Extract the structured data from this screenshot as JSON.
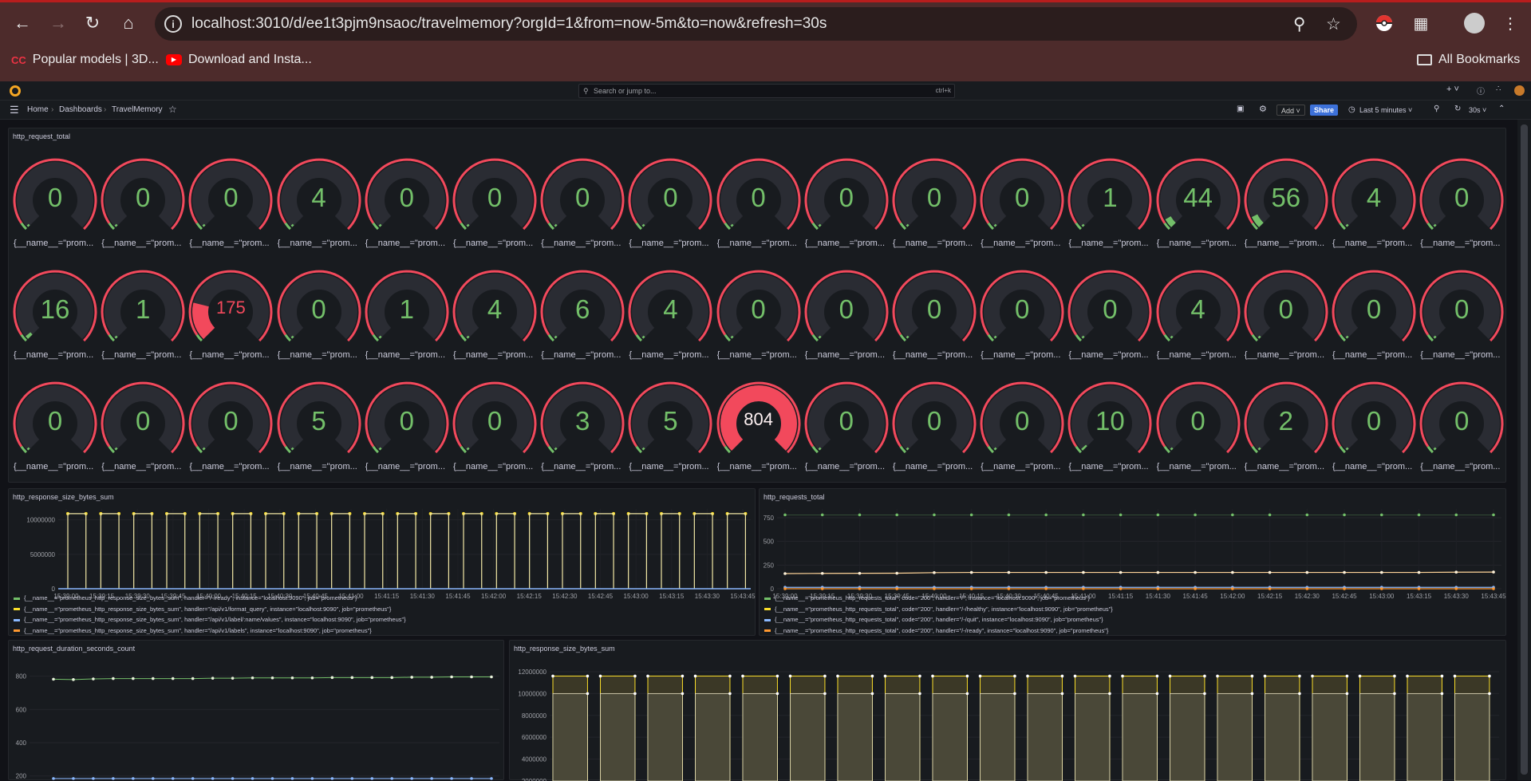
{
  "browser": {
    "url": "localhost:3010/d/ee1t3pjm9nsaoc/travelmemory?orgId=1&from=now-5m&to=now&refresh=30s",
    "bookmarks": [
      "Popular models | 3D...",
      "Download and Insta..."
    ],
    "all_bookmarks": "All Bookmarks",
    "accent": "#4d2b2b"
  },
  "grafana": {
    "search_placeholder": "Search or jump to...",
    "search_shortcut": "ctrl+k",
    "breadcrumb": [
      "Home",
      "Dashboards",
      "TravelMemory"
    ],
    "add_label": "Add",
    "share_label": "Share",
    "time_range": "Last 5 minutes",
    "refresh": "30s"
  },
  "gauge_panel": {
    "title": "http_request_total",
    "label": "{__name__=\"prom...",
    "rows": [
      [
        0,
        0,
        0,
        4,
        0,
        0,
        0,
        0,
        0,
        0,
        0,
        0,
        1,
        44,
        56,
        4,
        0
      ],
      [
        16,
        1,
        175,
        0,
        1,
        4,
        6,
        4,
        0,
        0,
        0,
        0,
        0,
        4,
        0,
        0,
        0
      ],
      [
        0,
        0,
        0,
        5,
        0,
        0,
        3,
        5,
        804,
        0,
        0,
        0,
        10,
        0,
        2,
        0,
        0
      ]
    ],
    "thresholds": {
      "green": "#73bf69",
      "red": "#f2495c"
    }
  },
  "panels": {
    "p1": {
      "title": "http_response_size_bytes_sum",
      "legend": [
        {
          "text": "{__name__=\"prometheus_http_response_size_bytes_sum\", handler=\"/-/ready\", instance=\"localhost:9090\", job=\"prometheus\"}",
          "color": "#73bf69"
        },
        {
          "text": "{__name__=\"prometheus_http_response_size_bytes_sum\", handler=\"/api/v1/format_query\", instance=\"localhost:9090\", job=\"prometheus\"}",
          "color": "#fade2a"
        },
        {
          "text": "{__name__=\"prometheus_http_response_size_bytes_sum\", handler=\"/api/v1/label/:name/values\", instance=\"localhost:9090\", job=\"prometheus\"}",
          "color": "#8ab8ff"
        },
        {
          "text": "{__name__=\"prometheus_http_response_size_bytes_sum\", handler=\"/api/v1/labels\", instance=\"localhost:9090\", job=\"prometheus\"}",
          "color": "#ff9830"
        }
      ]
    },
    "p2": {
      "title": "http_requests_total",
      "legend": [
        {
          "text": "{__name__=\"prometheus_http_requests_total\", code=\"200\", handler=\"/\", instance=\"localhost:9090\", job=\"prometheus\"}",
          "color": "#73bf69"
        },
        {
          "text": "{__name__=\"prometheus_http_requests_total\", code=\"200\", handler=\"/-/healthy\", instance=\"localhost:9090\", job=\"prometheus\"}",
          "color": "#fade2a"
        },
        {
          "text": "{__name__=\"prometheus_http_requests_total\", code=\"200\", handler=\"/-/quit\", instance=\"localhost:9090\", job=\"prometheus\"}",
          "color": "#8ab8ff"
        },
        {
          "text": "{__name__=\"prometheus_http_requests_total\", code=\"200\", handler=\"/-/ready\", instance=\"localhost:9090\", job=\"prometheus\"}",
          "color": "#ff9830"
        }
      ]
    },
    "p3": {
      "title": "http_request_duration_seconds_count"
    },
    "p4": {
      "title": "http_response_size_bytes_sum"
    }
  },
  "chart_data": [
    {
      "type": "line",
      "title": "http_response_size_bytes_sum",
      "x": [
        "15:39:00",
        "15:39:15",
        "15:39:30",
        "15:39:45",
        "15:40:00",
        "15:40:15",
        "15:40:30",
        "15:40:45",
        "15:41:00",
        "15:41:15",
        "15:41:30",
        "15:41:45",
        "15:42:00",
        "15:42:15",
        "15:42:30",
        "15:42:45",
        "15:43:00",
        "15:43:15",
        "15:43:30",
        "15:43:45"
      ],
      "yticks": [
        "0",
        "5000000",
        "10000000"
      ],
      "ylim": [
        0,
        11000000
      ],
      "series": [
        {
          "name": "handler=/api/v1/format_query",
          "pattern": "square wave between 0 and ~11000000"
        }
      ]
    },
    {
      "type": "line",
      "title": "http_requests_total",
      "x": [
        "15:39:00",
        "15:39:15",
        "15:39:30",
        "15:39:45",
        "15:40:00",
        "15:40:15",
        "15:40:30",
        "15:40:45",
        "15:41:00",
        "15:41:15",
        "15:41:30",
        "15:41:45",
        "15:42:00",
        "15:42:15",
        "15:42:30",
        "15:42:45",
        "15:43:00",
        "15:43:15",
        "15:43:30",
        "15:43:45"
      ],
      "yticks": [
        "0",
        "250",
        "500",
        "750"
      ],
      "ylim": [
        0,
        800
      ],
      "series": [
        {
          "name": "handler=/",
          "values": [
            780,
            780,
            780,
            780,
            780,
            780,
            780,
            780,
            780,
            780,
            780,
            780,
            780,
            780,
            780,
            780,
            780,
            780,
            780,
            780
          ]
        },
        {
          "name": "handler=/-/healthy",
          "values": [
            160,
            162,
            163,
            164,
            170,
            172,
            172,
            172,
            172,
            172,
            172,
            172,
            172,
            172,
            172,
            172,
            172,
            172,
            175,
            176
          ]
        },
        {
          "name": "handler=/-/quit",
          "values": [
            15,
            15,
            15,
            15,
            15,
            15,
            15,
            15,
            15,
            15,
            15,
            15,
            15,
            15,
            15,
            15,
            15,
            15,
            15,
            15
          ]
        },
        {
          "name": "handler=/-/ready",
          "values": [
            0,
            0,
            0,
            0,
            0,
            0,
            0,
            0,
            0,
            0,
            0,
            0,
            0,
            0,
            0,
            0,
            0,
            0,
            0,
            0
          ]
        }
      ]
    },
    {
      "type": "line",
      "title": "http_request_duration_seconds_count",
      "yticks": [
        "200",
        "400",
        "600",
        "800"
      ],
      "ylim": [
        170,
        880
      ],
      "series": [
        {
          "values": [
            782,
            780,
            784,
            786,
            786,
            786,
            786,
            786,
            788,
            788,
            790,
            790,
            790,
            790,
            792,
            792,
            792,
            792,
            794,
            794,
            796,
            796,
            796
          ]
        },
        {
          "values": [
            185,
            185,
            185,
            185,
            185,
            185,
            185,
            185,
            185,
            185,
            185,
            185,
            185,
            185,
            185,
            185,
            185,
            185,
            185,
            185,
            185,
            185,
            185
          ]
        }
      ]
    },
    {
      "type": "bar",
      "title": "http_response_size_bytes_sum",
      "yticks": [
        "2000000",
        "4000000",
        "6000000",
        "8000000",
        "10000000",
        "12000000"
      ],
      "ylim": [
        2000000,
        12800000
      ],
      "series": [
        {
          "values": [
            11600000,
            11600000,
            11600000,
            11600000,
            11600000,
            11600000,
            11600000,
            11600000,
            11600000,
            11600000,
            11600000,
            11600000,
            11600000,
            11600000,
            11600000,
            11600000,
            11600000,
            11600000,
            11600000,
            11600000
          ]
        },
        {
          "values": [
            10000000,
            10000000,
            10000000,
            10000000,
            10000000,
            10000000,
            10000000,
            10000000,
            10000000,
            10000000,
            10000000,
            10000000,
            10000000,
            10000000,
            10000000,
            10000000,
            10000000,
            10000000,
            10000000,
            10000000
          ]
        }
      ]
    }
  ]
}
